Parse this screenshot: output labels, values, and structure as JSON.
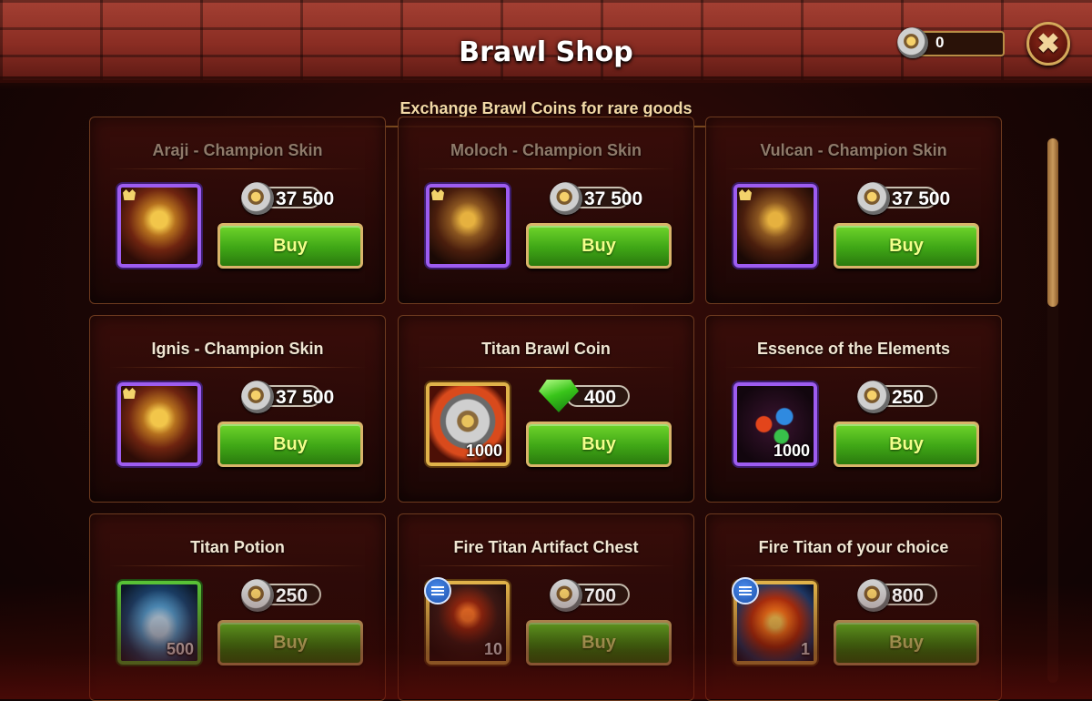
{
  "header": {
    "title": "Brawl Shop",
    "coin_balance": "0",
    "close_icon": "x-icon",
    "subtitle": "Exchange Brawl Coins for rare goods"
  },
  "items": [
    {
      "name": "Araji - Champion Skin",
      "price": "37 500",
      "currency": "brawl-coin-icon",
      "art": "champion-skin-icon",
      "buy": "Buy",
      "qty": ""
    },
    {
      "name": "Moloch - Champion Skin",
      "price": "37 500",
      "currency": "brawl-coin-icon",
      "art": "champion-skin-icon",
      "buy": "Buy",
      "qty": ""
    },
    {
      "name": "Vulcan - Champion Skin",
      "price": "37 500",
      "currency": "brawl-coin-icon",
      "art": "champion-skin-icon",
      "buy": "Buy",
      "qty": ""
    },
    {
      "name": "Ignis - Champion Skin",
      "price": "37 500",
      "currency": "brawl-coin-icon",
      "art": "champion-skin-icon",
      "buy": "Buy",
      "qty": ""
    },
    {
      "name": "Titan Brawl Coin",
      "price": "400",
      "currency": "emerald-icon",
      "art": "titan-brawl-coin-icon",
      "buy": "Buy",
      "qty": "1000"
    },
    {
      "name": "Essence of the Elements",
      "price": "250",
      "currency": "brawl-coin-icon",
      "art": "essence-icon",
      "buy": "Buy",
      "qty": "1000"
    },
    {
      "name": "Titan Potion",
      "price": "250",
      "currency": "brawl-coin-icon",
      "art": "titan-potion-icon",
      "buy": "Buy",
      "qty": "500"
    },
    {
      "name": "Fire Titan Artifact Chest",
      "price": "700",
      "currency": "brawl-coin-icon",
      "art": "artifact-chest-icon",
      "buy": "Buy",
      "qty": "10"
    },
    {
      "name": "Fire Titan of your choice",
      "price": "800",
      "currency": "brawl-coin-icon",
      "art": "fire-titan-icon",
      "buy": "Buy",
      "qty": "1"
    }
  ],
  "colors": {
    "accent_gold": "#d9b46a",
    "buy_green": "#3fa616",
    "skin_frame_purple": "#9d5cf0"
  }
}
